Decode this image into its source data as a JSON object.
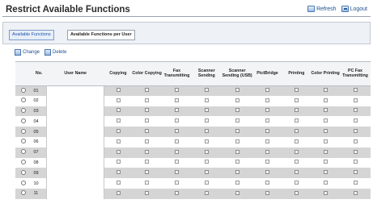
{
  "header": {
    "title": "Restrict Available Functions",
    "refresh_label": "Refresh",
    "logout_label": "Logout"
  },
  "tabs": [
    {
      "label": "Available Functions",
      "active": true
    },
    {
      "label": "Available Functions per User",
      "active": false
    }
  ],
  "toolbar": {
    "change_label": "Change",
    "delete_label": "Delete"
  },
  "table": {
    "columns": [
      "",
      "No.",
      "User Name",
      "Copying",
      "Color Copying",
      "Fax Transmitting",
      "Scanner Sending",
      "Scanner Sending (USB)",
      "PictBridge",
      "Printing",
      "Color Printing",
      "PC Fax Transmitting"
    ],
    "rows": [
      {
        "no": "01",
        "user_name": ""
      },
      {
        "no": "02",
        "user_name": ""
      },
      {
        "no": "03",
        "user_name": ""
      },
      {
        "no": "04",
        "user_name": ""
      },
      {
        "no": "05",
        "user_name": ""
      },
      {
        "no": "06",
        "user_name": ""
      },
      {
        "no": "07",
        "user_name": ""
      },
      {
        "no": "08",
        "user_name": ""
      },
      {
        "no": "09",
        "user_name": ""
      },
      {
        "no": "10",
        "user_name": ""
      },
      {
        "no": "11",
        "user_name": ""
      }
    ]
  }
}
